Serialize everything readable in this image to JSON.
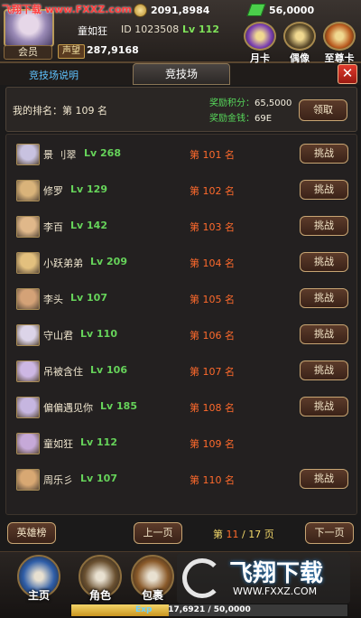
{
  "watermark_top": "飞翔下载 www.FXXZ.com",
  "player": {
    "vip_label": "会员",
    "name": "童如狂",
    "id": "ID 1023508",
    "level": "Lv 112",
    "power_badge": "声望",
    "power": "287,9168",
    "coins": "2091,8984",
    "gems": "56,0000"
  },
  "top_buttons": [
    {
      "label": "月卡",
      "color": "#7a3fb0"
    },
    {
      "label": "偶像",
      "color": "#5b4a2a"
    },
    {
      "label": "至尊卡",
      "color": "#b85a1e"
    }
  ],
  "tabs": {
    "rules": "竞技场说明",
    "active": "竞技场",
    "close": "✕"
  },
  "my_info": {
    "rank_label": "我的排名：第 109 名",
    "points_label": "奖励积分：",
    "points_value": "65,5000",
    "gold_label": "奖励金钱：",
    "gold_value": "69E",
    "claim": "领取"
  },
  "challenge_label": "挑战",
  "rows": [
    {
      "name": "景 刂翠",
      "level": "Lv 268",
      "rank": "第 101 名",
      "avatar": "#c8c2e0",
      "challenge": true
    },
    {
      "name": "修罗",
      "level": "Lv 129",
      "rank": "第 102 名",
      "avatar": "#d9b37a",
      "challenge": true
    },
    {
      "name": "李百",
      "level": "Lv 142",
      "rank": "第 103 名",
      "avatar": "#e0b88a",
      "challenge": true
    },
    {
      "name": "小跃弟弟",
      "level": "Lv 209",
      "rank": "第 104 名",
      "avatar": "#e3c07e",
      "challenge": true
    },
    {
      "name": "李头",
      "level": "Lv 107",
      "rank": "第 105 名",
      "avatar": "#d4a277",
      "challenge": true
    },
    {
      "name": "守山君",
      "level": "Lv 110",
      "rank": "第 106 名",
      "avatar": "#dcd4e8",
      "challenge": true
    },
    {
      "name": "吊被含住",
      "level": "Lv 106",
      "rank": "第 107 名",
      "avatar": "#cdb7e3",
      "challenge": true
    },
    {
      "name": "偏偏遇见你",
      "level": "Lv 185",
      "rank": "第 108 名",
      "avatar": "#c6b6e0",
      "challenge": true
    },
    {
      "name": "童如狂",
      "level": "Lv 112",
      "rank": "第 109 名",
      "avatar": "#c6a9d8",
      "challenge": false
    },
    {
      "name": "周乐彡",
      "level": "Lv 107",
      "rank": "第 110 名",
      "avatar": "#d8a873",
      "challenge": true
    }
  ],
  "footer": {
    "hero_list": "英雄榜",
    "prev": "上一页",
    "page_prefix": "第 ",
    "page_current": "11",
    "page_suffix": " / 17 页",
    "next": "下一页"
  },
  "bottom_nav": [
    {
      "label": "主页",
      "color": "#2f5ea8"
    },
    {
      "label": "角色",
      "color": "#6a5030"
    },
    {
      "label": "包裹",
      "color": "#8a5a2a"
    }
  ],
  "exp": {
    "label": "Exp",
    "text": "17,6921 / 50,0000",
    "fraction": 0.354
  },
  "watermark_logo": {
    "big": "飞翔下载",
    "small": "WWW.FXXZ.COM"
  }
}
